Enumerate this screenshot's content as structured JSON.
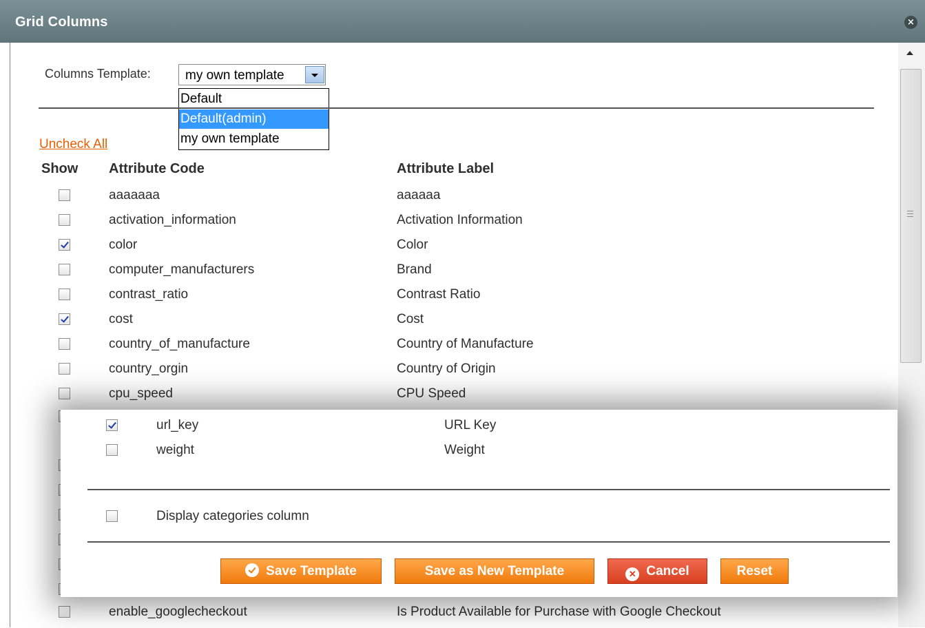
{
  "window": {
    "title": "Grid Columns",
    "close_glyph": "×"
  },
  "template": {
    "label": "Columns Template:",
    "selected": "my own template",
    "options": [
      "Default",
      "Default(admin)",
      "my own template"
    ],
    "highlighted_index": 1
  },
  "uncheck_all": "Uncheck All",
  "headers": {
    "show": "Show",
    "code": "Attribute Code",
    "label": "Attribute Label"
  },
  "rows": [
    {
      "code": "aaaaaaa",
      "label": "aaaaaa",
      "checked": false
    },
    {
      "code": "activation_information",
      "label": "Activation Information",
      "checked": false
    },
    {
      "code": "color",
      "label": "Color",
      "checked": true
    },
    {
      "code": "computer_manufacturers",
      "label": "Brand",
      "checked": false
    },
    {
      "code": "contrast_ratio",
      "label": "Contrast Ratio",
      "checked": false
    },
    {
      "code": "cost",
      "label": "Cost",
      "checked": true
    },
    {
      "code": "country_of_manufacture",
      "label": "Country of Manufacture",
      "checked": false
    },
    {
      "code": "country_orgin",
      "label": "Country of Origin",
      "checked": false
    },
    {
      "code": "cpu_speed",
      "label": "CPU Speed",
      "checked": false
    }
  ],
  "bottom_rows": [
    {
      "code": "enable_googlecheckout",
      "label": "Is Product Available for Purchase with Google Checkout",
      "checked": false
    }
  ],
  "overlay": {
    "rows": [
      {
        "code": "url_key",
        "label": "URL Key",
        "checked": true
      },
      {
        "code": "weight",
        "label": "Weight",
        "checked": false
      }
    ],
    "display_categories": {
      "label": "Display categories column",
      "checked": false
    },
    "buttons": {
      "save_template": "Save Template",
      "save_as_new": "Save as New Template",
      "cancel": "Cancel",
      "reset": "Reset"
    }
  },
  "colors": {
    "titlebar": "#6b8287",
    "link": "#eb5e00",
    "button": "#f58a1f",
    "cancel": "#e0502e",
    "selection": "#3399ff"
  },
  "icons": {
    "close": "close-icon",
    "save": "check-circle-icon",
    "cancel": "x-circle-icon",
    "scroll_up": "arrow-up-icon"
  }
}
